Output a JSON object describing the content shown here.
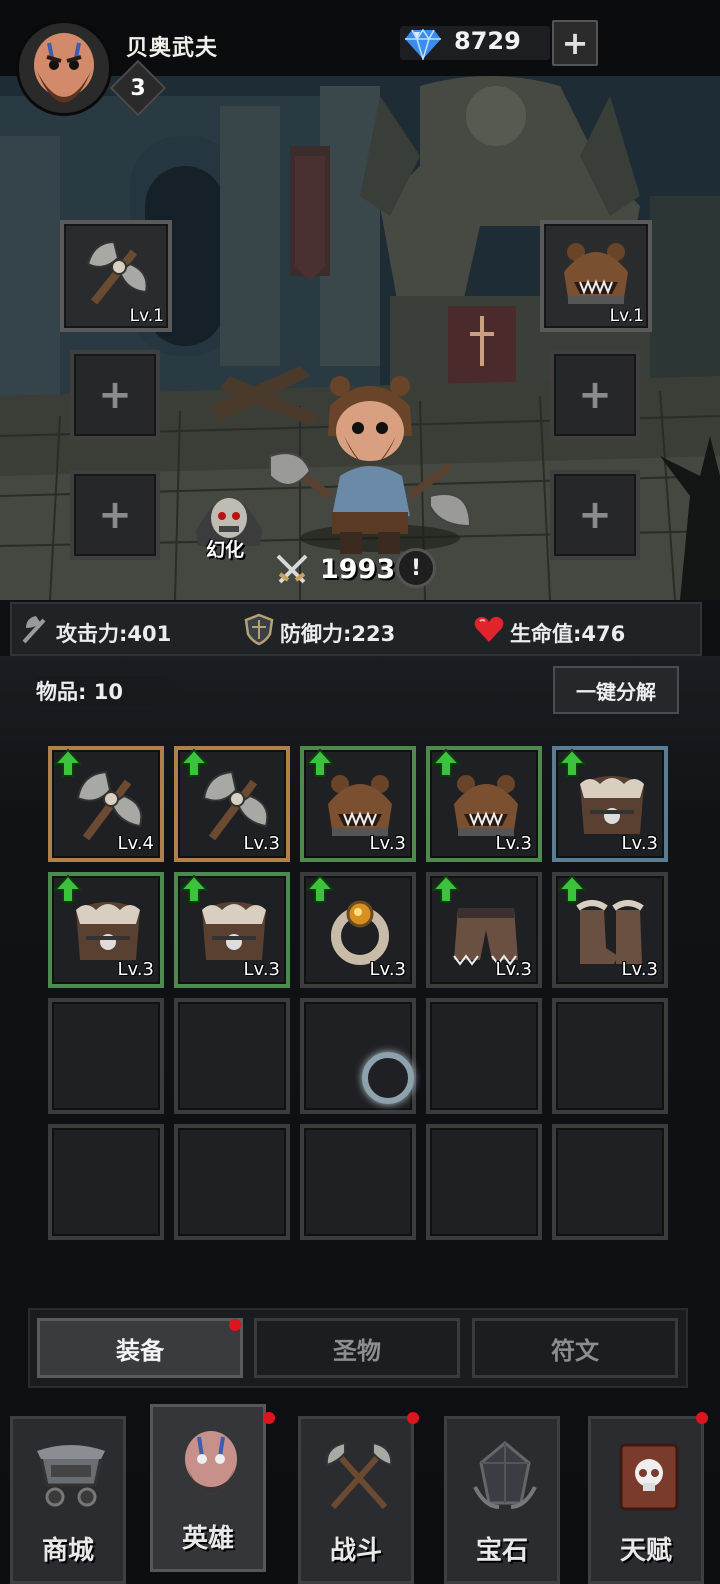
{
  "header": {
    "player_name": "贝奥武夫",
    "player_level": "3",
    "gem_count": "8729",
    "gem_add_label": "+"
  },
  "scene": {
    "left_weapon_level": "Lv.1",
    "right_helmet_level": "Lv.1",
    "empty_slot_label": "+",
    "skin_label": "幻化",
    "combat_power": "1993",
    "info_label": "!"
  },
  "stats": {
    "attack": "攻击力:401",
    "defense": "防御力:223",
    "hp": "生命值:476"
  },
  "inventory": {
    "count_label": "物品: 10",
    "dismantle_label": "一键分解",
    "items": [
      {
        "type": "axe",
        "level": "Lv.4",
        "rarity": "orange"
      },
      {
        "type": "axe",
        "level": "Lv.3",
        "rarity": "orange"
      },
      {
        "type": "bear-helmet",
        "level": "Lv.3",
        "rarity": "green"
      },
      {
        "type": "bear-helmet",
        "level": "Lv.3",
        "rarity": "green"
      },
      {
        "type": "fur-armor",
        "level": "Lv.3",
        "rarity": "blue"
      },
      {
        "type": "fur-armor",
        "level": "Lv.3",
        "rarity": "green"
      },
      {
        "type": "fur-armor",
        "level": "Lv.3",
        "rarity": "green"
      },
      {
        "type": "ring",
        "level": "Lv.3",
        "rarity": "gray"
      },
      {
        "type": "fur-pants",
        "level": "Lv.3",
        "rarity": "gray"
      },
      {
        "type": "fur-boots",
        "level": "Lv.3",
        "rarity": "gray"
      }
    ]
  },
  "tabs": [
    {
      "label": "装备"
    },
    {
      "label": "圣物"
    },
    {
      "label": "符文"
    }
  ],
  "nav": [
    {
      "label": "商城",
      "icon": "shop-cart-icon"
    },
    {
      "label": "英雄",
      "icon": "hero-icon"
    },
    {
      "label": "战斗",
      "icon": "crossed-axes-icon"
    },
    {
      "label": "宝石",
      "icon": "gem-stone-icon"
    },
    {
      "label": "天赋",
      "icon": "skull-book-icon"
    }
  ],
  "colors": {
    "rarity_orange": "#b0804a",
    "rarity_green": "#4e8a4e",
    "rarity_blue": "#5a7d93",
    "notification": "#e0141c",
    "upgrade_arrow": "#3cc23c"
  }
}
